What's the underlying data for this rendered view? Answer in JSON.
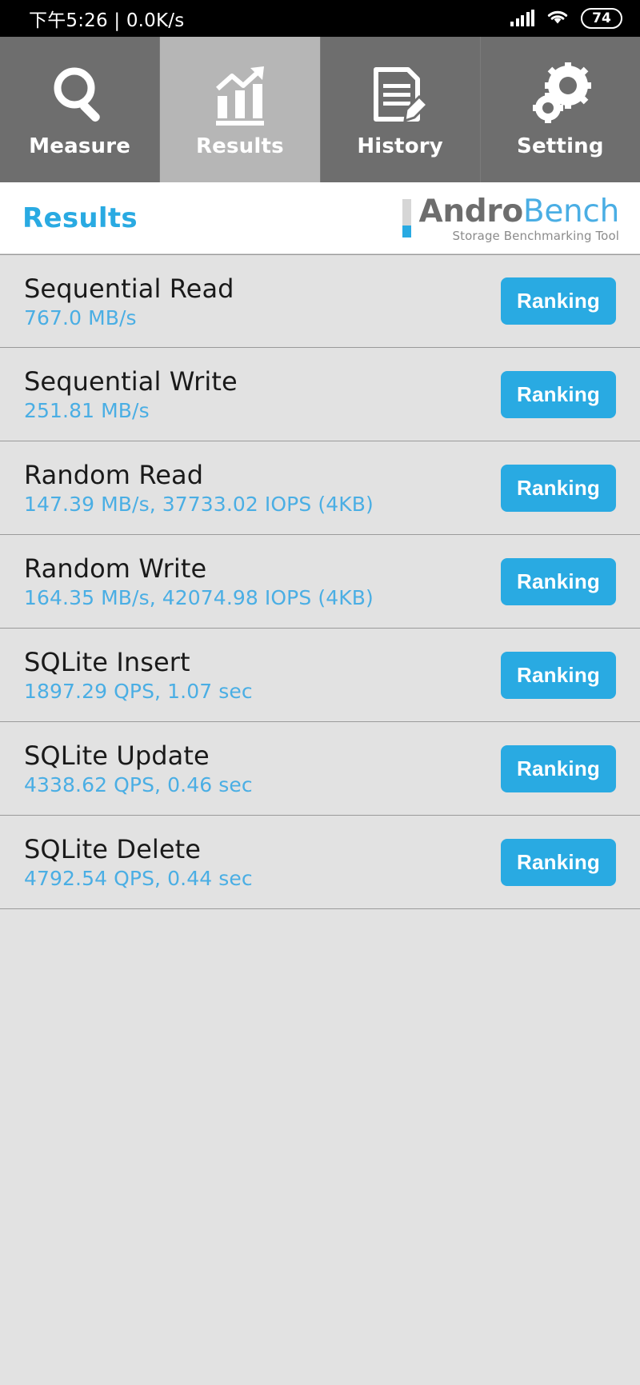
{
  "statusbar": {
    "time_text": "下午5:26 | 0.0K/s",
    "signal_icon": "signal-bars-icon",
    "wifi_icon": "wifi-icon",
    "battery_level": "74"
  },
  "tabs": [
    {
      "label": "Measure",
      "icon": "magnifier-icon",
      "active": false
    },
    {
      "label": "Results",
      "icon": "bar-chart-arrow-icon",
      "active": true
    },
    {
      "label": "History",
      "icon": "document-pencil-icon",
      "active": false
    },
    {
      "label": "Setting",
      "icon": "gears-icon",
      "active": false
    }
  ],
  "header": {
    "page_title": "Results",
    "logo_primary": "Andro",
    "logo_secondary": "Bench",
    "logo_tagline": "Storage Benchmarking Tool"
  },
  "results": {
    "ranking_label": "Ranking",
    "rows": [
      {
        "title": "Sequential Read",
        "value": "767.0 MB/s"
      },
      {
        "title": "Sequential Write",
        "value": "251.81 MB/s"
      },
      {
        "title": "Random Read",
        "value": "147.39 MB/s, 37733.02 IOPS (4KB)"
      },
      {
        "title": "Random Write",
        "value": "164.35 MB/s, 42074.98 IOPS (4KB)"
      },
      {
        "title": "SQLite Insert",
        "value": "1897.29 QPS, 1.07 sec"
      },
      {
        "title": "SQLite Update",
        "value": "4338.62 QPS, 0.46 sec"
      },
      {
        "title": "SQLite Delete",
        "value": "4792.54 QPS, 0.44 sec"
      }
    ]
  },
  "colors": {
    "accent_blue": "#29aae2",
    "value_blue": "#4aaee4",
    "tab_inactive": "#6e6e6e",
    "tab_active": "#b6b6b6",
    "list_bg": "#e2e2e2"
  }
}
